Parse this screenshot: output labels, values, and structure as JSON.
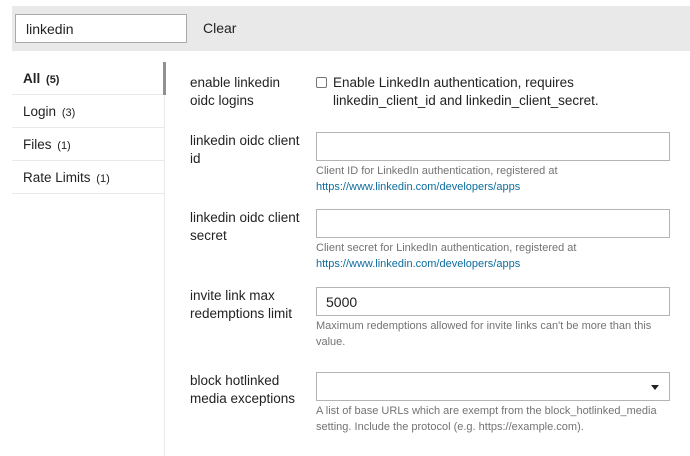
{
  "search": {
    "value": "linkedin",
    "clear_label": "Clear"
  },
  "sidebar": {
    "items": [
      {
        "label": "All",
        "count": "(5)"
      },
      {
        "label": "Login",
        "count": "(3)"
      },
      {
        "label": "Files",
        "count": "(1)"
      },
      {
        "label": "Rate Limits",
        "count": "(1)"
      }
    ]
  },
  "settings": {
    "enable_oidc": {
      "label": "enable linkedin oidc logins",
      "checkbox_text": "Enable LinkedIn authentication, requires linkedin_client_id and linkedin_client_secret."
    },
    "client_id": {
      "label": "linkedin oidc client id",
      "value": "",
      "help": "Client ID for LinkedIn authentication, registered at",
      "help_link": "https://www.linkedin.com/developers/apps"
    },
    "client_secret": {
      "label": "linkedin oidc client secret",
      "value": "",
      "help": "Client secret for LinkedIn authentication, registered at",
      "help_link": "https://www.linkedin.com/developers/apps"
    },
    "invite_limit": {
      "label": "invite link max redemptions limit",
      "value": "5000",
      "help": "Maximum redemptions allowed for invite links can't be more than this value."
    },
    "hotlinked": {
      "label": "block hotlinked media exceptions",
      "help": "A list of base URLs which are exempt from the block_hotlinked_media setting. Include the protocol (e.g. https://example.com)."
    }
  }
}
